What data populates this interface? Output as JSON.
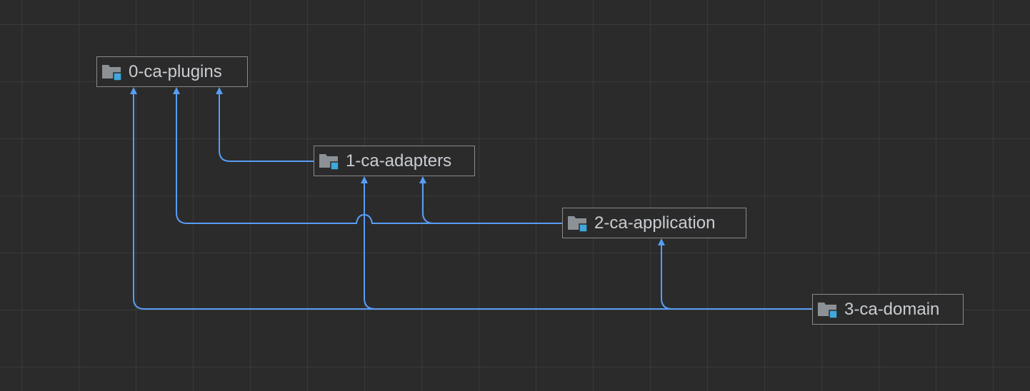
{
  "diagram": {
    "type": "module-dependency-graph",
    "nodes": [
      {
        "id": "0-ca-plugins",
        "label": "0-ca-plugins",
        "icon": "module-folder-icon"
      },
      {
        "id": "1-ca-adapters",
        "label": "1-ca-adapters",
        "icon": "module-folder-icon"
      },
      {
        "id": "2-ca-application",
        "label": "2-ca-application",
        "icon": "module-folder-icon"
      },
      {
        "id": "3-ca-domain",
        "label": "3-ca-domain",
        "icon": "module-folder-icon"
      }
    ],
    "edges": [
      {
        "from": "1-ca-adapters",
        "to": "0-ca-plugins"
      },
      {
        "from": "2-ca-application",
        "to": "0-ca-plugins"
      },
      {
        "from": "2-ca-application",
        "to": "1-ca-adapters"
      },
      {
        "from": "3-ca-domain",
        "to": "0-ca-plugins"
      },
      {
        "from": "3-ca-domain",
        "to": "1-ca-adapters"
      },
      {
        "from": "3-ca-domain",
        "to": "2-ca-application"
      }
    ]
  },
  "colors": {
    "background": "#2b2b2b",
    "grid": "#3a3a3a",
    "edge": "#589df6",
    "node_border": "#8a8a8a",
    "node_text": "#c9ccd1",
    "folder": "#8c9196",
    "module_badge": "#3fa8dc"
  }
}
